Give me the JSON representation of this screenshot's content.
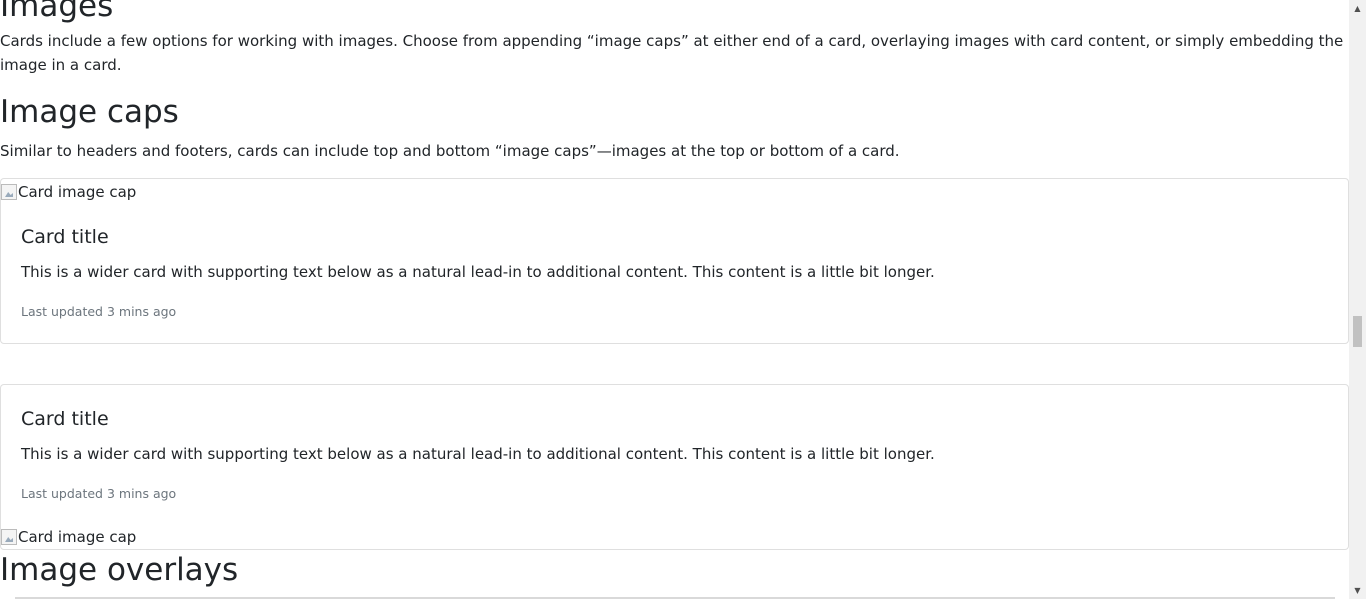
{
  "sections": {
    "images_heading": "Images",
    "images_desc": "Cards include a few options for working with images. Choose from appending “image caps” at either end of a card, overlaying images with card content, or simply embedding the image in a card.",
    "image_caps_heading": "Image caps",
    "image_caps_desc": "Similar to headers and footers, cards can include top and bottom “image caps”—images at the top or bottom of a card.",
    "image_overlays_heading": "Image overlays"
  },
  "cards": [
    {
      "image_alt": "Card image cap",
      "title": "Card title",
      "text": "This is a wider card with supporting text below as a natural lead-in to additional content. This content is a little bit longer.",
      "muted": "Last updated 3 mins ago"
    },
    {
      "image_alt": "Card image cap",
      "title": "Card title",
      "text": "This is a wider card with supporting text below as a natural lead-in to additional content. This content is a little bit longer.",
      "muted": "Last updated 3 mins ago"
    }
  ],
  "scrollbar": {
    "up_icon": "triangle-up",
    "down_icon": "triangle-down"
  }
}
